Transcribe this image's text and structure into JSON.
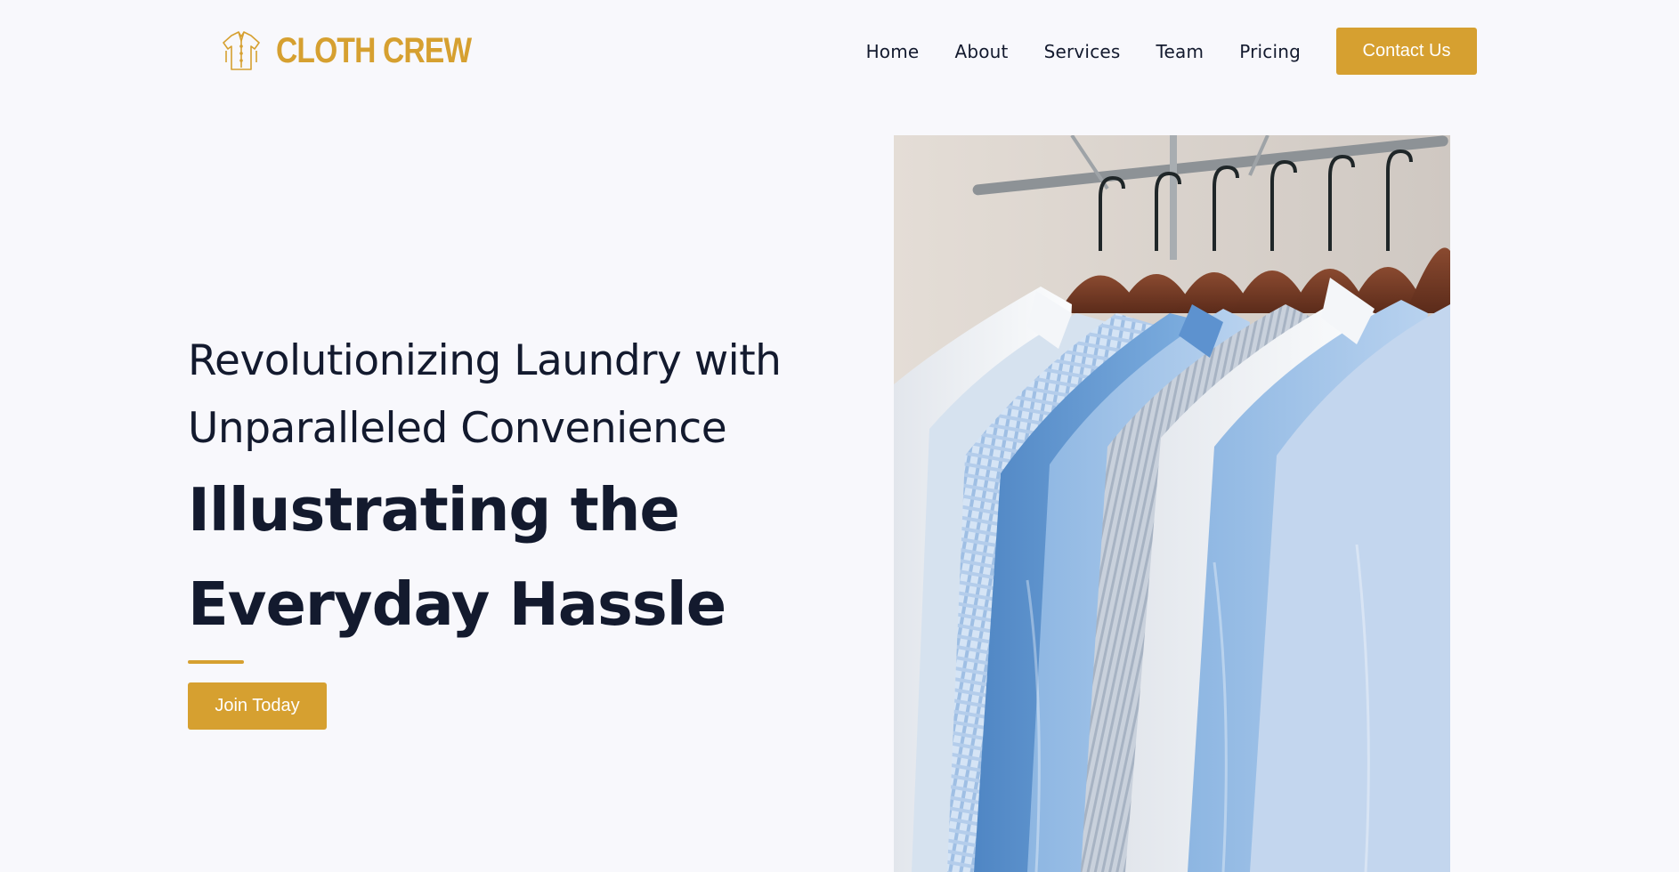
{
  "brand": {
    "name": "CLOTH CREW",
    "icon": "shirt-icon",
    "color": "#d6a030"
  },
  "nav": {
    "links": [
      "Home",
      "About",
      "Services",
      "Team",
      "Pricing"
    ],
    "cta": "Contact Us"
  },
  "hero": {
    "subtitle_line1": "Revolutionizing Laundry with",
    "subtitle_line2": "Unparalleled Convenience",
    "title_line1": "Illustrating the",
    "title_line2": "Everyday Hassle",
    "cta": "Join Today"
  },
  "colors": {
    "accent": "#d6a030",
    "text": "#131a2e",
    "background": "#f8f8fc"
  }
}
